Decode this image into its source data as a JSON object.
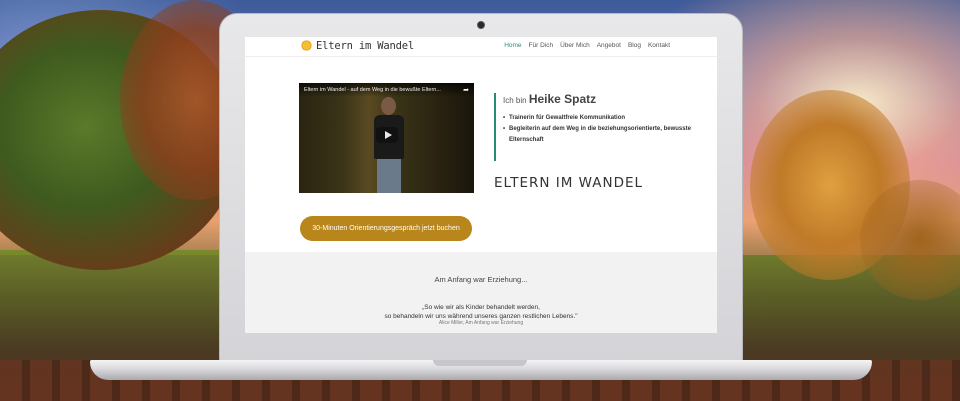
{
  "site": {
    "logo_text": "Eltern im Wandel",
    "nav": [
      {
        "label": "Home",
        "active": true
      },
      {
        "label": "Für Dich",
        "active": false
      },
      {
        "label": "Über Mich",
        "active": false
      },
      {
        "label": "Angebot",
        "active": false
      },
      {
        "label": "Blog",
        "active": false
      },
      {
        "label": "Kontakt",
        "active": false
      }
    ]
  },
  "video": {
    "title": "Eltern im Wandel - auf dem Weg in die bewußte Eltern...",
    "share_icon": "share-icon",
    "play_icon": "play-icon"
  },
  "intro": {
    "prefix": "Ich bin",
    "name": "Heike Spatz",
    "items": [
      "Trainerin für Gewaltfreie Kommunikation",
      "Begleiterin auf dem Weg in die beziehungsorientierte, bewusste Elternschaft"
    ]
  },
  "brand_title": "ELTERN IM WANDEL",
  "cta": {
    "label": "30-Minuten Orientierungsgespräch jetzt buchen"
  },
  "section": {
    "title": "Am Anfang war Erziehung...",
    "quote_line1": "„So wie wir als Kinder behandelt werden,",
    "quote_line2": "so behandeln wir uns während unseres ganzen restlichen Lebens.\"",
    "quote_source": "Alice Miller, Am Anfang war Erziehung"
  },
  "colors": {
    "accent": "#2a8a7a",
    "button": "#b8861b",
    "section_bg": "#f2f2f2"
  }
}
